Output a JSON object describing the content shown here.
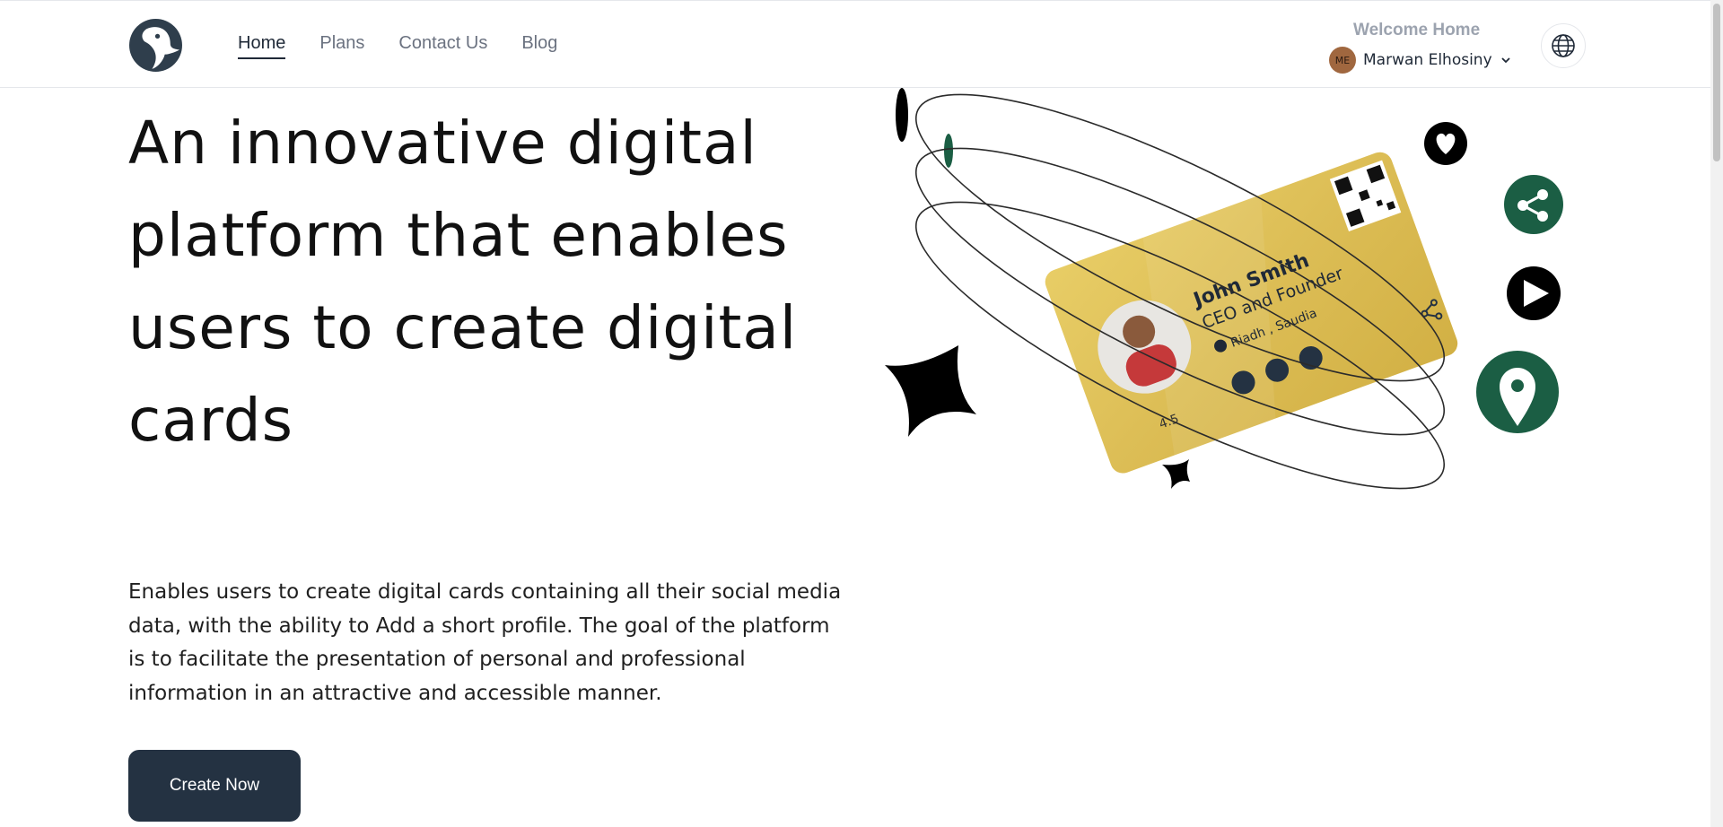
{
  "header": {
    "nav": [
      {
        "label": "Home",
        "active": true
      },
      {
        "label": "Plans"
      },
      {
        "label": "Contact Us"
      },
      {
        "label": "Blog"
      }
    ],
    "welcome": "Welcome Home",
    "user": {
      "initials": "ME",
      "name": "Marwan Elhosiny"
    },
    "icons": [
      "penguin-logo",
      "chevron-down-icon",
      "globe-icon"
    ]
  },
  "hero": {
    "headline": "An innovative digital platform that enables users to create digital cards",
    "description": "Enables users to create digital cards containing all their social media data, with the ability to Add a short profile. The goal of the platform is to facilitate the presentation of personal and professional information in an attractive and accessible manner.",
    "cta": "Create Now"
  },
  "card": {
    "name": "John Smith",
    "title": "CEO and Founder",
    "location": "Riadh , Saudia",
    "rating": "4.5"
  },
  "colors": {
    "primary": "#243242",
    "accent_green": "#1b5e44",
    "card_gold": "#e0c256"
  }
}
